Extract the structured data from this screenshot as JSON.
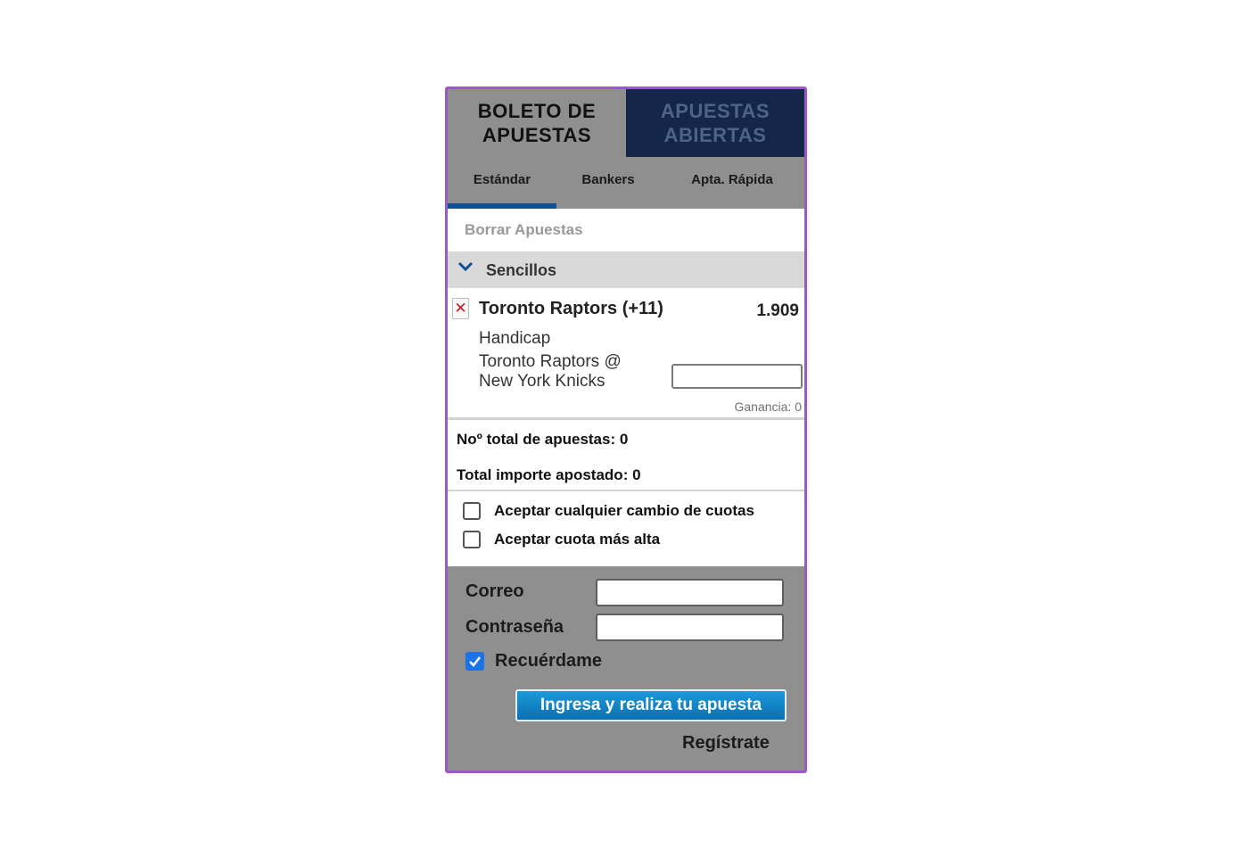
{
  "top_tabs": {
    "bet_slip": "BOLETO DE\nAPUESTAS",
    "open_bets": "APUESTAS\nABIERTAS"
  },
  "sub_tabs": {
    "standard": "Estándar",
    "bankers": "Bankers",
    "quick_bet": "Apta. Rápida",
    "active": "standard"
  },
  "clear_bets": "Borrar Apuestas",
  "section": {
    "label": "Sencillos",
    "icon": "chevron-down-icon"
  },
  "bet": {
    "selection": "Toronto Raptors (+11)",
    "odds": "1.909",
    "market": "Handicap",
    "event": "Toronto Raptors @ New York Knicks",
    "stake_value": "",
    "winnings": "Ganancia: 0"
  },
  "totals": {
    "bet_count": "Noº total de apuestas: 0",
    "total_staked": "Total importe apostado:  0"
  },
  "options": {
    "accept_any_odds": "Aceptar cualquier cambio de cuotas",
    "accept_higher_odds": "Aceptar cuota más alta"
  },
  "login": {
    "email_label": "Correo",
    "password_label": "Contraseña",
    "email_value": "",
    "password_value": "",
    "remember_label": "Recuérdame",
    "remember_checked": true,
    "submit_label": "Ingresa y realiza tu apuesta",
    "register_label": "Regístrate"
  },
  "colors": {
    "frame_border": "#9b59c8",
    "panel_gray": "#8f8f8f",
    "inactive_tab": "#14274a",
    "active_underline": "#0f4f93",
    "remove_x": "#d0141b",
    "submit_button": "#1c9ad9",
    "checkbox_checked": "#1a73e8"
  }
}
